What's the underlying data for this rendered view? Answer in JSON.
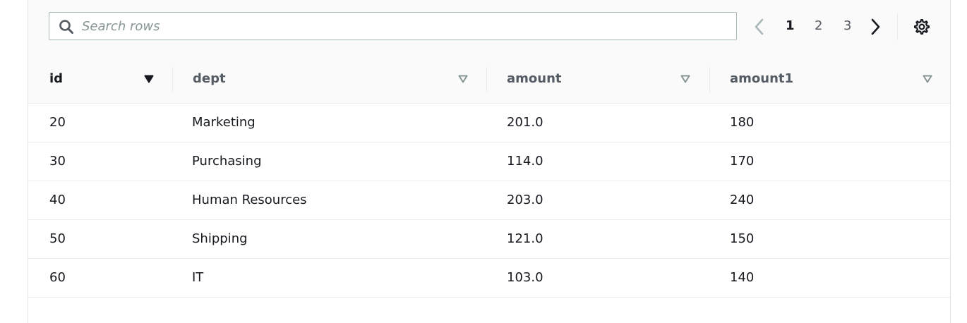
{
  "search": {
    "placeholder": "Search rows",
    "value": ""
  },
  "pagination": {
    "pages": [
      "1",
      "2",
      "3"
    ],
    "current": "1"
  },
  "table": {
    "columns": [
      {
        "label": "id",
        "sorted": true
      },
      {
        "label": "dept",
        "sorted": false
      },
      {
        "label": "amount",
        "sorted": false
      },
      {
        "label": "amount1",
        "sorted": false
      }
    ],
    "rows": [
      [
        "20",
        "Marketing",
        "201.0",
        "180"
      ],
      [
        "30",
        "Purchasing",
        "114.0",
        "170"
      ],
      [
        "40",
        "Human Resources",
        "203.0",
        "240"
      ],
      [
        "50",
        "Shipping",
        "121.0",
        "150"
      ],
      [
        "60",
        "IT",
        "103.0",
        "140"
      ]
    ]
  },
  "icons": {
    "search": "search-icon",
    "prev": "chevron-left-icon",
    "next": "chevron-right-icon",
    "settings": "gear-icon",
    "sort_active": "caret-down-filled-icon",
    "sort_inactive": "caret-down-outline-icon"
  },
  "colors": {
    "text": "#16191f",
    "muted": "#545b64",
    "placeholder": "#879596",
    "border": "#eaeded",
    "header_bg": "#fafafa"
  }
}
